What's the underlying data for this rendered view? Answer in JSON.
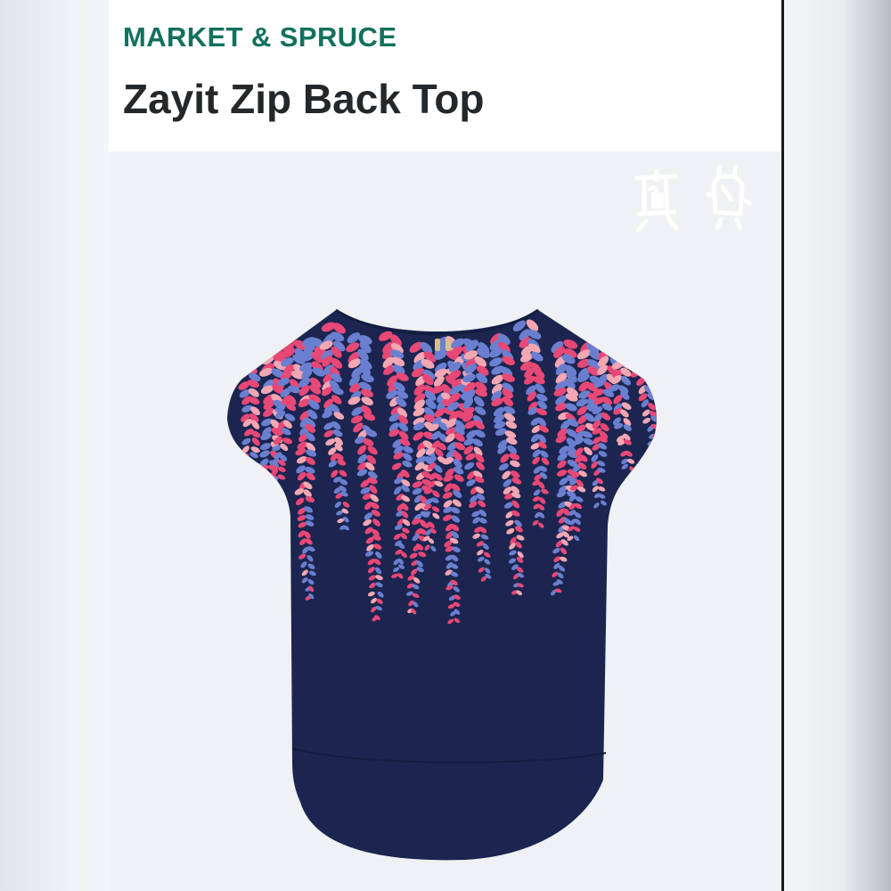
{
  "header": {
    "brand": "MARKET & SPRUCE",
    "title": "Zayit Zip Back Top"
  },
  "toolbar": {
    "icons": [
      "hanger-icon",
      "outfit-icon"
    ]
  },
  "product": {
    "image": "floral-print-top-image",
    "colors": {
      "garment": "#1b2550",
      "flower_pink": "#e84876",
      "flower_light_pink": "#f2a7b3",
      "leaf_blue": "#6b7fd0"
    }
  },
  "colors": {
    "brand": "#13705e",
    "title": "#25282b",
    "background": "#eff1f4"
  }
}
